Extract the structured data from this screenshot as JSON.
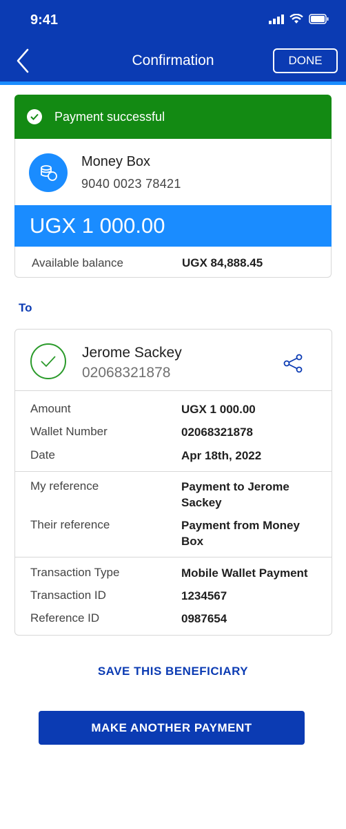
{
  "status_bar": {
    "time": "9:41"
  },
  "header": {
    "title": "Confirmation",
    "done_label": "DONE"
  },
  "banner": {
    "text": "Payment successful"
  },
  "source": {
    "name": "Money Box",
    "number": "9040 0023 78421",
    "amount": "UGX 1 000.00",
    "balance_label": "Available balance",
    "balance_value": "UGX 84,888.45"
  },
  "to_label": "To",
  "beneficiary": {
    "name": "Jerome Sackey",
    "number": "02068321878"
  },
  "details": {
    "group1": [
      {
        "label": "Amount",
        "value": "UGX 1 000.00"
      },
      {
        "label": "Wallet Number",
        "value": "02068321878"
      },
      {
        "label": "Date",
        "value": "Apr 18th, 2022"
      }
    ],
    "group2": [
      {
        "label": "My reference",
        "value": "Payment to Jerome Sackey"
      },
      {
        "label": "Their reference",
        "value": "Payment from Money Box"
      }
    ],
    "group3": [
      {
        "label": "Transaction Type",
        "value": "Mobile Wallet Payment"
      },
      {
        "label": "Transaction ID",
        "value": "1234567"
      },
      {
        "label": "Reference ID",
        "value": "0987654"
      }
    ]
  },
  "actions": {
    "save_beneficiary": "SAVE THIS BENEFICIARY",
    "make_another": "MAKE ANOTHER PAYMENT"
  },
  "colors": {
    "header": "#0b3bb3",
    "accent": "#1a8cff",
    "success": "#138a13"
  }
}
